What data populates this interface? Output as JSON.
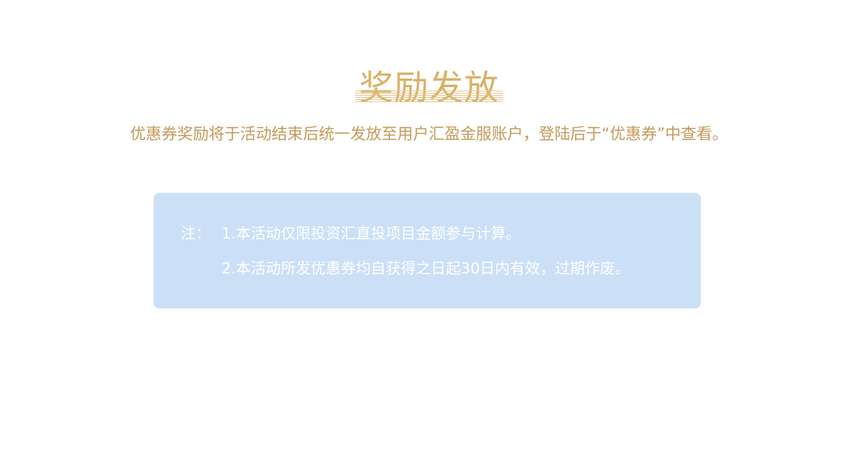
{
  "section": {
    "title": "奖励发放",
    "description": "优惠券奖励将于活动结束后统一发放至用户汇盈金服账户，登陆后于“优惠券”中查看。"
  },
  "note": {
    "label": "注：",
    "items": [
      "1.本活动仅限投资汇直投项目金额参与计算。",
      "2.本活动所发优惠券均自获得之日起30日内有效，过期作废。"
    ]
  },
  "colors": {
    "title": "#d9b168",
    "description": "#c29a5a",
    "note_background": "#cbdff7",
    "note_text": "#ffffff"
  }
}
